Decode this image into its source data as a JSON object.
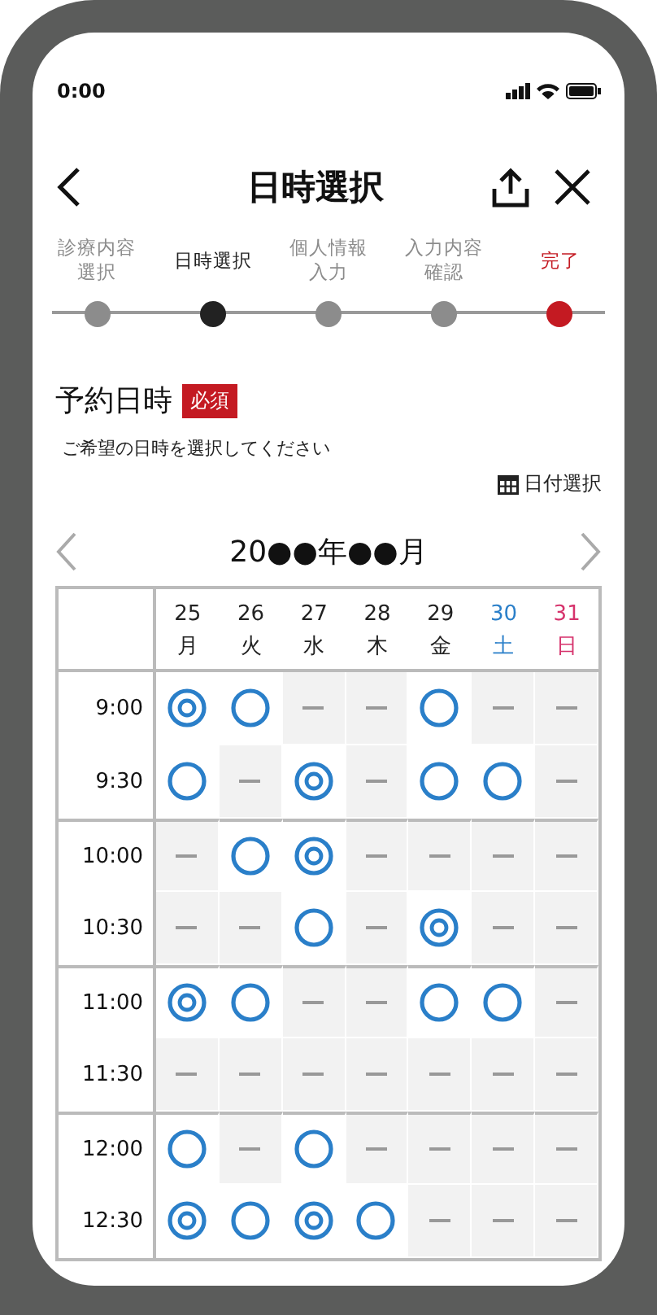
{
  "status_bar": {
    "time": "0:00"
  },
  "header": {
    "title": "日時選択"
  },
  "steps": [
    {
      "label": "診療内容選択",
      "color": "#8c8c8c"
    },
    {
      "label": "日時選択",
      "color": "#222222"
    },
    {
      "label": "個人情報入力",
      "color": "#8c8c8c"
    },
    {
      "label": "入力内容確認",
      "color": "#8c8c8c"
    },
    {
      "label": "完了",
      "color": "#c41a22"
    }
  ],
  "section": {
    "title": "予約日時",
    "badge": "必須",
    "hint": "ご希望の日時を選択してください",
    "date_picker": "日付選択"
  },
  "month": "20●●年●●月",
  "days": [
    {
      "date": "25",
      "weekday": "月",
      "color": "#222222"
    },
    {
      "date": "26",
      "weekday": "火",
      "color": "#222222"
    },
    {
      "date": "27",
      "weekday": "水",
      "color": "#222222"
    },
    {
      "date": "28",
      "weekday": "木",
      "color": "#222222"
    },
    {
      "date": "29",
      "weekday": "金",
      "color": "#222222"
    },
    {
      "date": "30",
      "weekday": "土",
      "color": "#2a7fc9"
    },
    {
      "date": "31",
      "weekday": "日",
      "color": "#d6336c"
    }
  ],
  "slots": [
    {
      "time": "9:00",
      "cells": [
        {
          "kind": "double"
        },
        {
          "kind": "circle"
        },
        {
          "kind": "dash"
        },
        {
          "kind": "dash"
        },
        {
          "kind": "circle"
        },
        {
          "kind": "dash"
        },
        {
          "kind": "dash"
        }
      ]
    },
    {
      "time": "9:30",
      "cells": [
        {
          "kind": "circle"
        },
        {
          "kind": "dash"
        },
        {
          "kind": "double"
        },
        {
          "kind": "dash"
        },
        {
          "kind": "circle"
        },
        {
          "kind": "circle"
        },
        {
          "kind": "dash"
        }
      ]
    },
    {
      "time": "10:00",
      "cells": [
        {
          "kind": "dash"
        },
        {
          "kind": "circle"
        },
        {
          "kind": "double"
        },
        {
          "kind": "dash"
        },
        {
          "kind": "dash"
        },
        {
          "kind": "dash"
        },
        {
          "kind": "dash"
        }
      ]
    },
    {
      "time": "10:30",
      "cells": [
        {
          "kind": "dash"
        },
        {
          "kind": "dash"
        },
        {
          "kind": "circle"
        },
        {
          "kind": "dash"
        },
        {
          "kind": "double"
        },
        {
          "kind": "dash"
        },
        {
          "kind": "dash"
        }
      ]
    },
    {
      "time": "11:00",
      "cells": [
        {
          "kind": "double"
        },
        {
          "kind": "circle"
        },
        {
          "kind": "dash"
        },
        {
          "kind": "dash"
        },
        {
          "kind": "circle"
        },
        {
          "kind": "circle"
        },
        {
          "kind": "dash"
        }
      ]
    },
    {
      "time": "11:30",
      "cells": [
        {
          "kind": "dash"
        },
        {
          "kind": "dash"
        },
        {
          "kind": "dash"
        },
        {
          "kind": "dash"
        },
        {
          "kind": "dash"
        },
        {
          "kind": "dash"
        },
        {
          "kind": "dash"
        }
      ]
    },
    {
      "time": "12:00",
      "cells": [
        {
          "kind": "circle"
        },
        {
          "kind": "dash"
        },
        {
          "kind": "circle"
        },
        {
          "kind": "dash"
        },
        {
          "kind": "dash"
        },
        {
          "kind": "dash"
        },
        {
          "kind": "dash"
        }
      ]
    },
    {
      "time": "12:30",
      "cells": [
        {
          "kind": "double"
        },
        {
          "kind": "circle"
        },
        {
          "kind": "double"
        },
        {
          "kind": "circle"
        },
        {
          "kind": "dash"
        },
        {
          "kind": "dash"
        },
        {
          "kind": "dash"
        }
      ]
    }
  ]
}
